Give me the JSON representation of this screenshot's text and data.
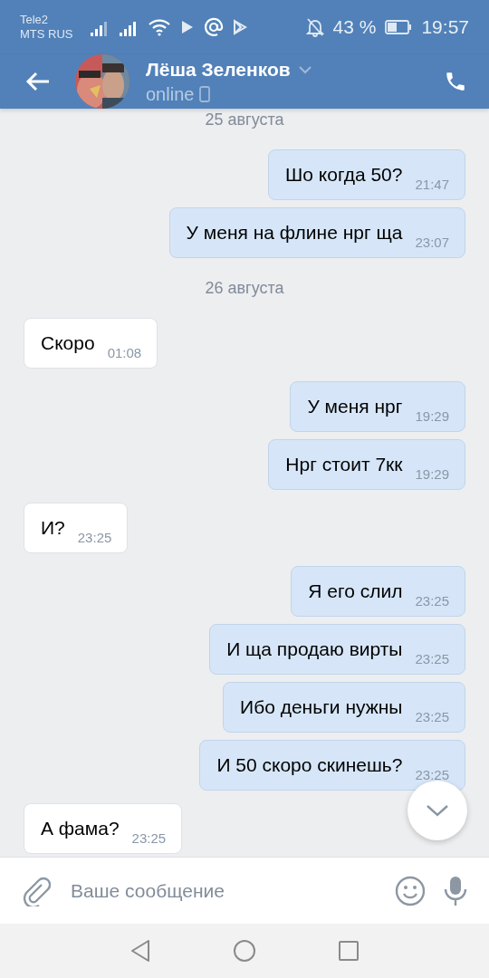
{
  "status_bar": {
    "carriers": [
      "Tele2",
      "MTS RUS"
    ],
    "battery": "43 %",
    "time": "19:57"
  },
  "header": {
    "name": "Лёша Зеленков",
    "status": "online"
  },
  "messages": [
    {
      "kind": "date",
      "text": "25 августа"
    },
    {
      "kind": "outgoing",
      "text": "Шо когда 50?",
      "time": "21:47"
    },
    {
      "kind": "outgoing",
      "text": "У меня на флине нрг ща",
      "time": "23:07"
    },
    {
      "kind": "date",
      "text": "26 августа"
    },
    {
      "kind": "incoming",
      "text": "Скоро",
      "time": "01:08"
    },
    {
      "kind": "outgoing",
      "text": "У меня нрг",
      "time": "19:29"
    },
    {
      "kind": "outgoing",
      "text": "Нрг стоит 7кк",
      "time": "19:29"
    },
    {
      "kind": "incoming",
      "text": "И?",
      "time": "23:25"
    },
    {
      "kind": "outgoing",
      "text": "Я его слил",
      "time": "23:25"
    },
    {
      "kind": "outgoing",
      "text": "И ща продаю вирты",
      "time": "23:25"
    },
    {
      "kind": "outgoing",
      "text": "Ибо деньги нужны",
      "time": "23:25"
    },
    {
      "kind": "outgoing",
      "text": "И 50 скоро скинешь?",
      "time": "23:25"
    },
    {
      "kind": "incoming",
      "text": "А фама?",
      "time": "23:25"
    }
  ],
  "composer": {
    "placeholder": "Ваше сообщение"
  }
}
